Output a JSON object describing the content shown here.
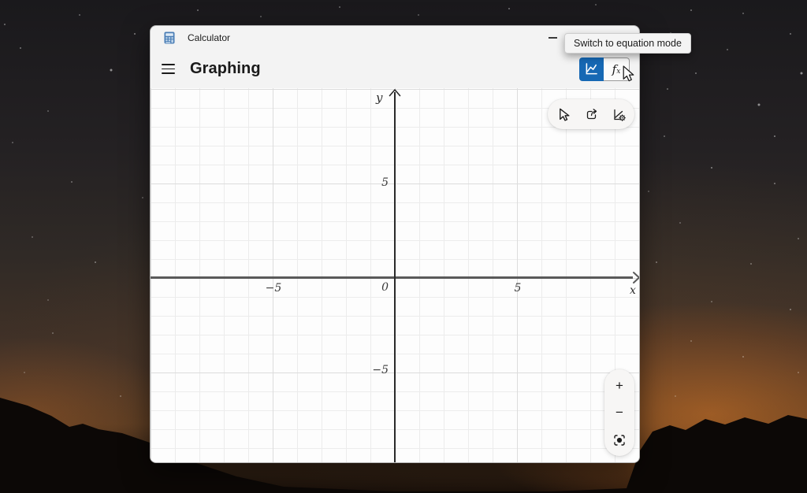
{
  "window": {
    "titlebar": {
      "app_name": "Calculator"
    },
    "header": {
      "title": "Graphing"
    },
    "mode_toggle": {
      "graph_button_selected": true,
      "fx_label": "f",
      "fx_sub": "x"
    },
    "tooltip": "Switch to equation mode"
  },
  "graph": {
    "axis_labels": {
      "x": "x",
      "y": "y"
    },
    "ticks": {
      "x_neg5": "−5",
      "x_pos5": "5",
      "y_pos5": "5",
      "y_neg5": "−5",
      "origin": "0"
    },
    "visible_x_range": [
      -10,
      10
    ],
    "visible_y_range": [
      -10,
      10
    ],
    "plotted_functions": []
  },
  "zoom_controls": {
    "zoom_in": "+",
    "zoom_out": "−"
  },
  "icons": {
    "app": "calculator-icon",
    "menu": "hamburger-menu-icon",
    "minimize": "minimize-icon",
    "graph_mode": "line-chart-icon",
    "equation_mode": "fx-icon",
    "trace": "trace-pointer-icon",
    "share": "share-icon",
    "graph_options": "graph-settings-icon",
    "fit_view": "center-view-icon",
    "cursor": "mouse-pointer-icon"
  },
  "colors": {
    "accent_blue": "#1668b4",
    "window_chrome": "#f3f3f3",
    "graph_background": "#fdfdfd",
    "grid_minor": "#ececec",
    "grid_major": "#dcdcdc",
    "x_axis": "#5a5a5a",
    "y_axis": "#2a2a2a"
  }
}
